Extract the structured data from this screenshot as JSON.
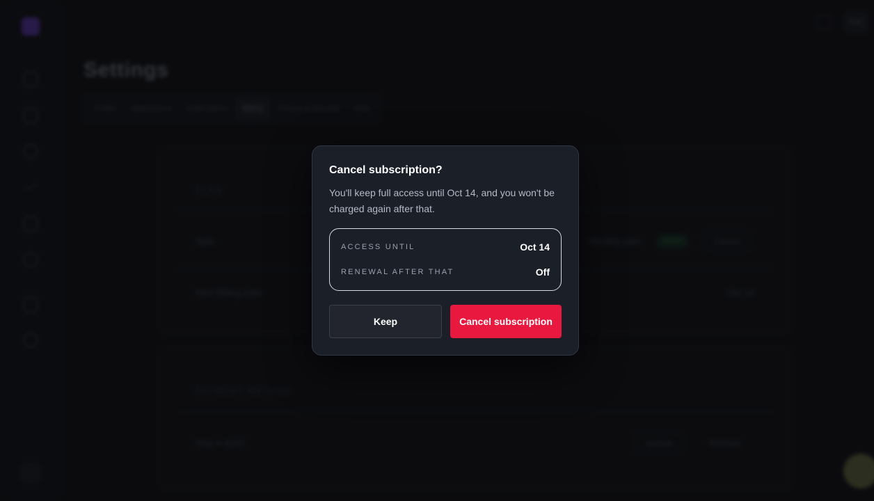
{
  "app": {
    "avatar_initials": "MM"
  },
  "page": {
    "title": "Settings",
    "tabs": [
      {
        "label": "Profile"
      },
      {
        "label": "Appearance"
      },
      {
        "label": "Notifications"
      },
      {
        "label": "Billing",
        "active": true
      },
      {
        "label": "Privacy & Security"
      },
      {
        "label": "Help"
      }
    ]
  },
  "plan_card": {
    "section_label": "PLAN",
    "plan_name": "Syllo",
    "plan_type": "Monthly plan",
    "status_badge": "Active",
    "cancel_label": "Cancel",
    "next_billing_label": "Next Billing Date",
    "next_billing_value": "Oct 14"
  },
  "payment_card": {
    "section_label": "PAYMENT METHOD",
    "card_label": "Visa •• 4242",
    "update_label": "Update",
    "remove_label": "Remove"
  },
  "modal": {
    "title": "Cancel subscription?",
    "body": "You'll keep full access until Oct 14, and you won't be charged again after that.",
    "rows": [
      {
        "key": "ACCESS UNTIL",
        "value": "Oct 14"
      },
      {
        "key": "RENEWAL AFTER THAT",
        "value": "Off"
      }
    ],
    "keep_label": "Keep",
    "confirm_label": "Cancel subscription"
  },
  "colors": {
    "accent_danger": "#e8183f",
    "modal_bg": "#1b1f28"
  }
}
